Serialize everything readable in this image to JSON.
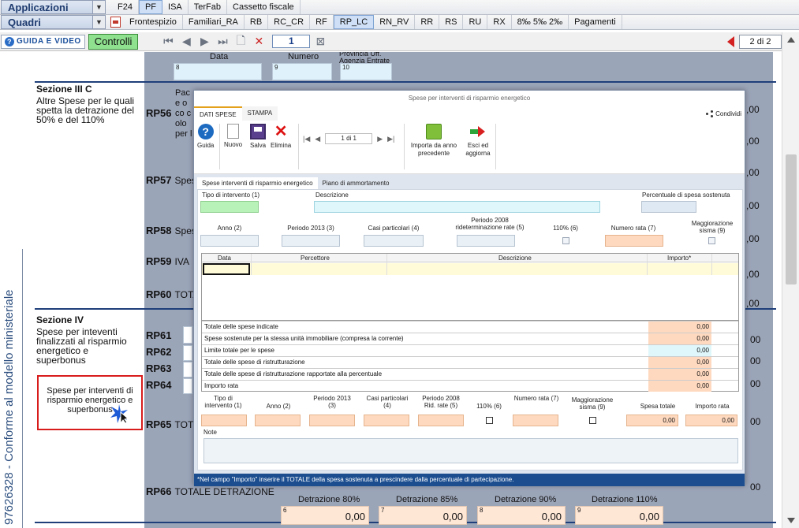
{
  "menu": {
    "applicazioni": "Applicazioni",
    "quadri": "Quadri",
    "top_tabs": [
      "F24",
      "PF",
      "ISA",
      "TerFab",
      "Cassetto fiscale"
    ],
    "top_active": 1,
    "quadri_tabs": [
      "Frontespizio",
      "Familiari_RA",
      "RB",
      "RC_CR",
      "RF",
      "RP_LC",
      "RN_RV",
      "RR",
      "RS",
      "RU",
      "RX",
      "8‰ 5‰ 2‰",
      "Pagamenti"
    ],
    "quadri_active": 5
  },
  "toolbar": {
    "guida_label": "GUIDA E VIDEO",
    "controlli_label": "Controlli",
    "page_value": "1",
    "page_count": "2 di 2"
  },
  "form": {
    "top_labels": {
      "data": "Data",
      "numero": "Numero",
      "provincia": "Provincia Uff. Agenzia Entrate"
    },
    "top_nums": [
      "8",
      "9",
      "10"
    ],
    "sez3c_title": "Sezione III C",
    "sez3c_desc": "Altre Spese per le quali spetta la detrazione del 50% e del 110%",
    "rp56_text": "Pace o co colo per l",
    "sez4_title": "Sezione IV",
    "sez4_desc": "Spese per inteventi finalizzati al risparmio energetico e superbonus",
    "rows": [
      {
        "code": "RP56",
        "text": ""
      },
      {
        "code": "RP57",
        "text": "Spes"
      },
      {
        "code": "RP58",
        "text": "Spes"
      },
      {
        "code": "RP59",
        "text": "IVA"
      },
      {
        "code": "RP60",
        "text": "TOTA"
      },
      {
        "code": "RP61",
        "text": ""
      },
      {
        "code": "RP62",
        "text": ""
      },
      {
        "code": "RP63",
        "text": ""
      },
      {
        "code": "RP64",
        "text": ""
      },
      {
        "code": "RP65",
        "text": "TOT"
      },
      {
        "code": "RP66",
        "text": "TOTALE DETRAZIONE"
      }
    ],
    "right_vals": [
      ",00",
      ",00",
      ",00",
      ",00",
      ",00",
      ",00",
      ",00",
      "00",
      "00",
      "00",
      "00",
      "00"
    ],
    "redbox_text": "Spese per interventi di risparmio energetico e superbonus",
    "vertical_text": "97626328 - Conforme al modello ministeriale",
    "detrazioni": [
      {
        "label": "Detrazione 80%",
        "num": "6",
        "value": "0,00"
      },
      {
        "label": "Detrazione 85%",
        "num": "7",
        "value": "0,00"
      },
      {
        "label": "Detrazione 90%",
        "num": "8",
        "value": "0,00"
      },
      {
        "label": "Detrazione 110%",
        "num": "9",
        "value": "0,00"
      }
    ]
  },
  "dialog": {
    "title": "Spese per interventi di risparmio energetico",
    "tabs": [
      "DATI SPESE",
      "STAMPA"
    ],
    "condividi": "Condividi",
    "buttons": {
      "guida": "Guida",
      "nuovo": "Nuovo",
      "salva": "Salva",
      "elimina": "Elimina",
      "importa": "Importa da anno precedente",
      "esci": "Esci ed aggiorna"
    },
    "pager": "1 di 1",
    "subtabs": [
      "Spese interventi di risparmio energetico",
      "Piano di ammortamento"
    ],
    "labels": {
      "tipo": "Tipo di intervento (1)",
      "descrizione": "Descrizione",
      "percentuale": "Percentuale di spesa sostenuta",
      "anno": "Anno (2)",
      "periodo2013": "Periodo 2013 (3)",
      "casi": "Casi particolari (4)",
      "periodo2008": "Periodo 2008 rideterminazione rate (5)",
      "p110": "110% (6)",
      "numero_rata": "Numero rata (7)",
      "maggiorazione": "Maggiorazione sisma (9)"
    },
    "grid_cols": [
      "Data",
      "Percettore",
      "Descrizione",
      "Importo*"
    ],
    "totals": [
      {
        "label": "Totale delle spese indicate",
        "value": "0,00"
      },
      {
        "label": "Spese sostenute per la stessa unità immobiliare (compresa la corrente)",
        "value": "0,00"
      },
      {
        "label": "Limite totale per le spese",
        "value": "0,00"
      },
      {
        "label": "Totale delle spese di ristrutturazione",
        "value": "0,00"
      },
      {
        "label": "Totale delle spese di ristrutturazione rapportate alla percentuale",
        "value": "0,00"
      },
      {
        "label": "Importo rata",
        "value": "0,00"
      }
    ],
    "bottom_labels": {
      "tipo": "Tipo di intervento (1)",
      "anno": "Anno (2)",
      "periodo": "Periodo 2013 (3)",
      "casi": "Casi particolari (4)",
      "p2008": "Periodo 2008 Rid. rate (5)",
      "p110": "110% (6)",
      "numero": "Numero rata (7)",
      "magg": "Maggiorazione sisma (9)",
      "spesa_totale": "Spesa totale",
      "importo_rata": "Importo rata"
    },
    "spesa_totale_value": "0,00",
    "importo_rata_value": "0,00",
    "note_label": "Note",
    "footnote": "*Nel campo \"Importo\" inserire il TOTALE della spesa sostenuta a prescindere dalla percentuale di partecipazione."
  }
}
